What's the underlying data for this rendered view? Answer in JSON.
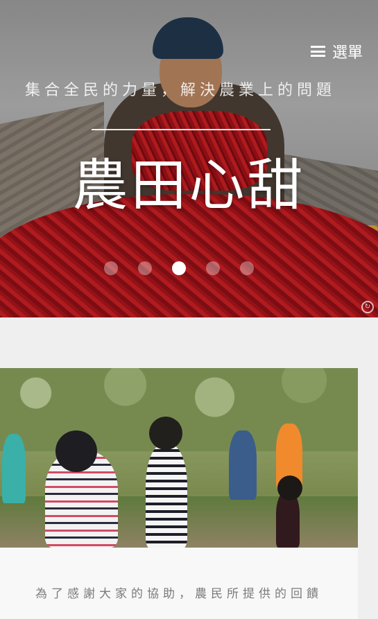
{
  "header": {
    "menu_label": "選單"
  },
  "hero": {
    "subtitle": "集合全民的力量，解決農業上的問題",
    "title": "農田心甜",
    "slides": [
      {
        "active": false
      },
      {
        "active": false
      },
      {
        "active": true
      },
      {
        "active": false
      },
      {
        "active": false
      }
    ]
  },
  "feature": {
    "caption": "為了感謝大家的協助，農民所提供的回饋"
  },
  "icons": {
    "menu": "hamburger-icon",
    "reload": "refresh-icon"
  },
  "colors": {
    "page_background": "#efefef",
    "card_background": "#f8f8f8",
    "caption_text": "#7a7a7a",
    "hero_text": "#ffffff"
  }
}
